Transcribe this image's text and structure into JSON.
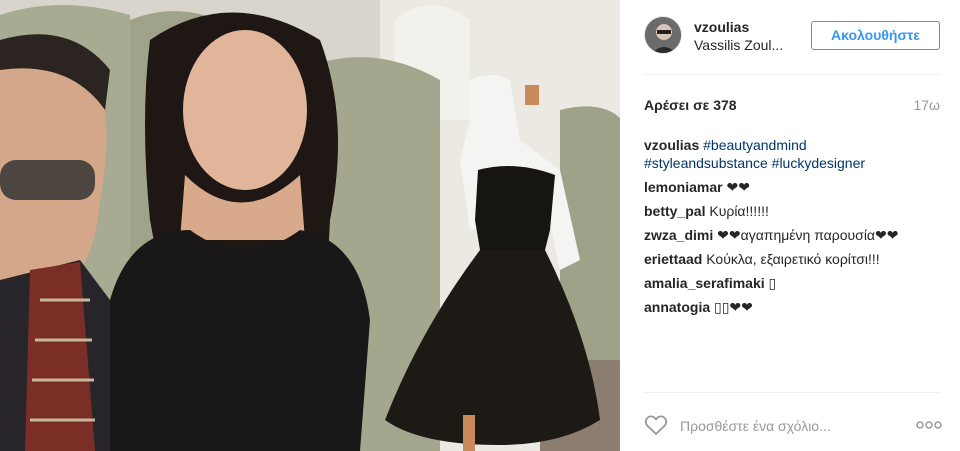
{
  "post": {
    "username": "vzoulias",
    "full_name": "Vassilis Zoul...",
    "follow_label": "Ακολουθήστε",
    "likes_label": "Αρέσει σε 378",
    "age": "17ω",
    "add_comment_placeholder": "Προσθέστε ένα σχόλιο...",
    "caption": {
      "user": "vzoulias",
      "tags": [
        "#beautyandmind",
        "#styleandsubstance",
        "#luckydesigner"
      ]
    },
    "comments": [
      {
        "user": "lemoniamar",
        "text": "❤❤"
      },
      {
        "user": "betty_pal",
        "text": "Κυρία!!!!!!"
      },
      {
        "user": "zwza_dimi",
        "text": "❤❤αγαπημένη παρουσία❤❤"
      },
      {
        "user": "eriettaad",
        "text": "Κούκλα, εξαιρετικό κορίτσι!!!"
      },
      {
        "user": "amalia_serafimaki",
        "text": "▯"
      },
      {
        "user": "annatogia",
        "text": "▯▯❤❤"
      }
    ]
  },
  "icons": {
    "heart": "heart-icon",
    "more": "more-options-icon"
  },
  "colors": {
    "link": "#003569",
    "follow": "#3897f0",
    "muted": "#999999"
  }
}
